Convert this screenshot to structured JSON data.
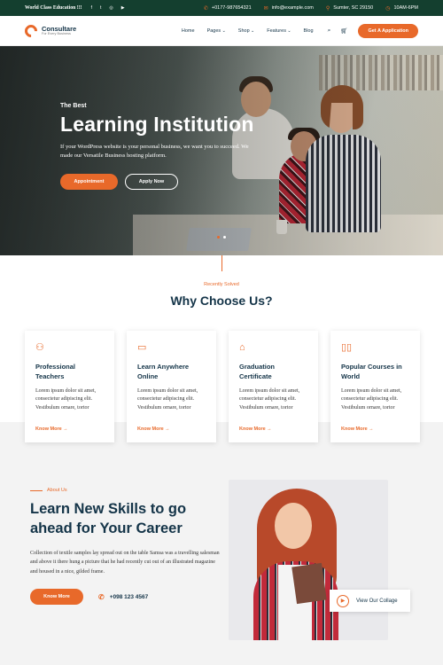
{
  "topbar": {
    "brand": "World Class Education !!!",
    "social": [
      "f",
      "t",
      "◎",
      "▶"
    ],
    "phone": "+0177-987654321",
    "email": "info@example.com",
    "location": "Sumter, SC 29150",
    "hours": "10AM-6PM"
  },
  "nav": {
    "logo_name": "Consultare",
    "logo_tagline": "For Every Business",
    "items": [
      "Home",
      "Pages",
      "Shop",
      "Features",
      "Blog"
    ],
    "cta": "Get A Application"
  },
  "hero": {
    "eyebrow": "The Best",
    "title": "Learning Institution",
    "description": "If your WordPress website is your personal business, we want you to succeed. We made our Versatile Business hosting platform.",
    "btn_primary": "Appointment",
    "btn_secondary": "Apply Now"
  },
  "why": {
    "eyebrow": "Recently Solved",
    "title": "Why Choose Us?",
    "cards": [
      {
        "icon": "teacher-icon",
        "title": "Professional Teachers",
        "text": "Lorem ipsum dolor sit amet, consectetur adipiscing elit. Vestibulum ornare, tortor",
        "link": "Know More →"
      },
      {
        "icon": "online-icon",
        "title": "Learn Anywhere Online",
        "text": "Lorem ipsum dolor sit amet, consectetur adipiscing elit. Vestibulum ornare, tortor",
        "link": "Know More →"
      },
      {
        "icon": "graduation-cap-icon",
        "title": "Graduation Certificate",
        "text": "Lorem ipsum dolor sit amet, consectetur adipiscing elit. Vestibulum ornare, tortor",
        "link": "Know More →"
      },
      {
        "icon": "book-icon",
        "title": "Popular Courses in World",
        "text": "Lorem ipsum dolor sit amet, consectetur adipiscing elit. Vestibulum ornare, tortor",
        "link": "Know More →"
      }
    ]
  },
  "about": {
    "eyebrow": "About Us",
    "title": "Learn New Skills to go ahead for Your Career",
    "text": "Collection of textile samples lay spread out on the table Samsa was a travelling salesman and above it there hung a picture that he had recently cut out of an illustrated magazine and housed in a nice, gilded frame.",
    "btn": "Know More",
    "phone": "+098 123 4567",
    "video_label": "View Our Collage"
  },
  "colors": {
    "accent": "#e8692a",
    "dark": "#143448",
    "topbar": "#143f2f"
  }
}
